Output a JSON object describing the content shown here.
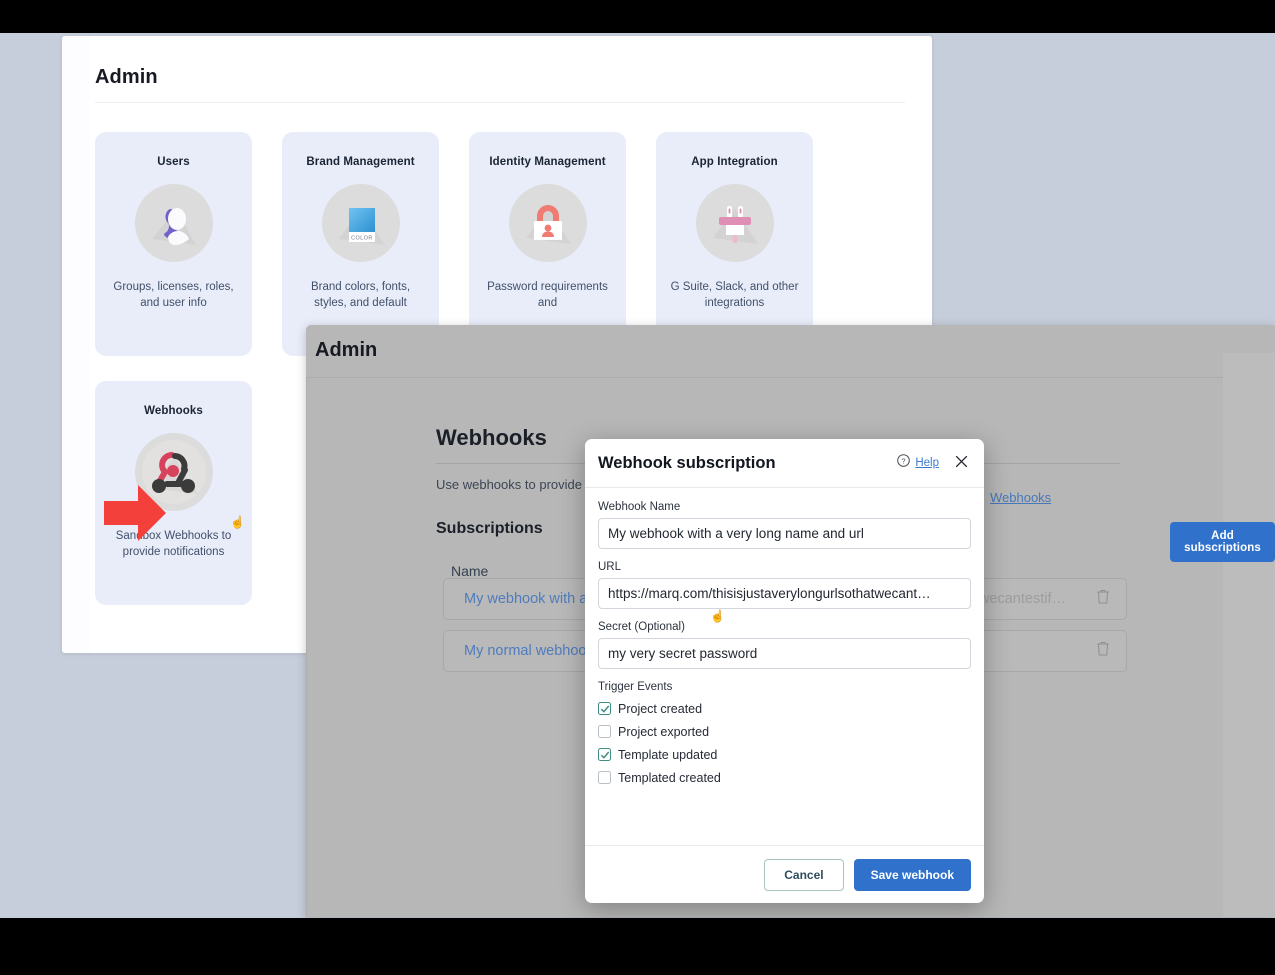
{
  "window_back": {
    "title": "Admin",
    "cards": [
      {
        "title": "Users",
        "desc": "Groups, licenses, roles, and user info",
        "icon": "user-avatar-icon"
      },
      {
        "title": "Brand Management",
        "desc": "Brand colors, fonts, styles, and default",
        "icon": "color-swatch-icon",
        "swatch_label": "COLOR"
      },
      {
        "title": "Identity Management",
        "desc": "Password requirements and",
        "icon": "padlock-user-icon"
      },
      {
        "title": "App Integration",
        "desc": "G Suite, Slack, and other integrations",
        "icon": "plug-icon"
      }
    ],
    "cards_row2": [
      {
        "title": "Webhooks",
        "desc": "Sandbox Webhooks to provide notifications",
        "icon": "webhook-icon"
      }
    ]
  },
  "window_front": {
    "title": "Admin",
    "webhooks": {
      "heading": "Webhooks",
      "description_prefix": "Use webhooks to provide",
      "description_link": "Webhooks",
      "subscriptions_heading": "Subscriptions",
      "column_name": "Name",
      "add_button": "Add subscriptions",
      "rows": [
        {
          "name": "My webhook with a",
          "url": "wecantestif…",
          "trash": "trash-icon"
        },
        {
          "name": "My normal webhoo",
          "url": "",
          "trash": "trash-icon"
        }
      ]
    }
  },
  "modal": {
    "title": "Webhook subscription",
    "help_label": "Help",
    "help_icon": "question-circle-icon",
    "close_icon": "close-icon",
    "fields": {
      "name_label": "Webhook Name",
      "name_value": "My webhook with a very long name and url",
      "url_label": "URL",
      "url_value": "https://marq.com/thisisjustaverylongurlsothatwecant…",
      "secret_label": "Secret (Optional)",
      "secret_value": "my very secret password"
    },
    "trigger_events_label": "Trigger Events",
    "trigger_events": [
      {
        "label": "Project created",
        "checked": true
      },
      {
        "label": "Project exported",
        "checked": false
      },
      {
        "label": "Template updated",
        "checked": true
      },
      {
        "label": "Templated created",
        "checked": false
      }
    ],
    "cancel_label": "Cancel",
    "save_label": "Save webhook"
  },
  "annotation": {
    "arrow": "red-arrow-pointer"
  },
  "colors": {
    "primary_blue": "#3072cb",
    "link_blue": "#3a7ad1",
    "card_bg": "#e8edf9",
    "arrow_red": "#f4403a",
    "checkbox_teal": "#3f8c80"
  }
}
